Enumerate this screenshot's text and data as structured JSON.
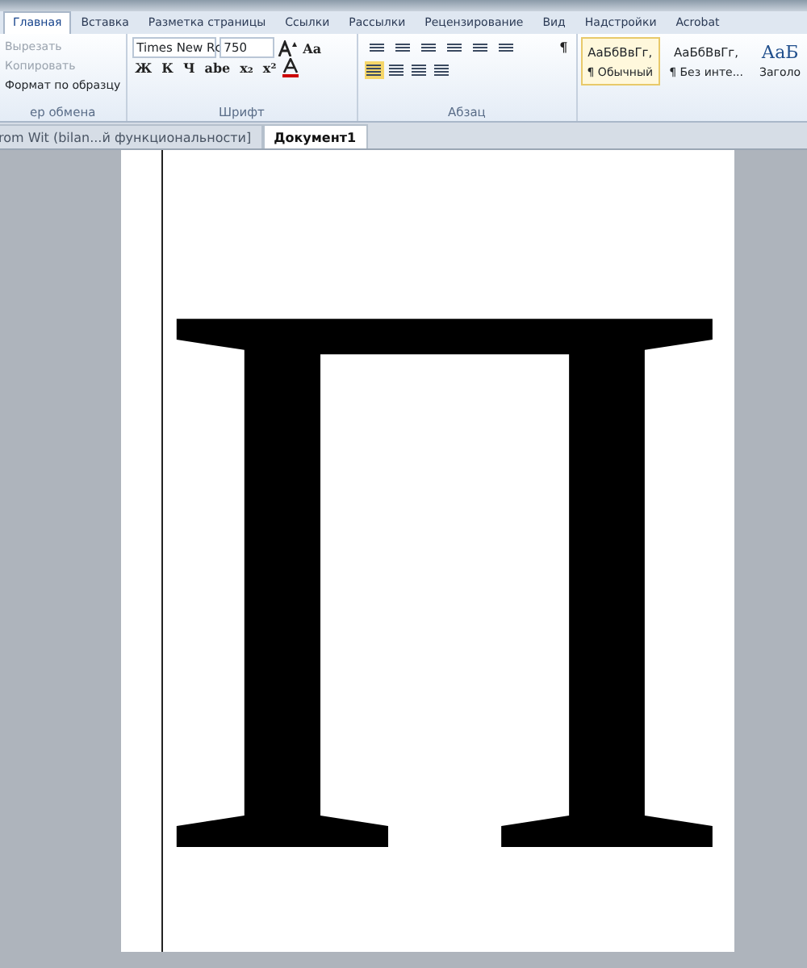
{
  "ribbon_tabs": [
    {
      "label": "Главная",
      "selected": true
    },
    {
      "label": "Вставка",
      "selected": false
    },
    {
      "label": "Разметка страницы",
      "selected": false
    },
    {
      "label": "Ссылки",
      "selected": false
    },
    {
      "label": "Рассылки",
      "selected": false
    },
    {
      "label": "Рецензирование",
      "selected": false
    },
    {
      "label": "Вид",
      "selected": false
    },
    {
      "label": "Надстройки",
      "selected": false
    },
    {
      "label": "Acrobat",
      "selected": false
    }
  ],
  "clipboard": {
    "items": [
      {
        "label": "Вырезать",
        "disabled": true
      },
      {
        "label": "Копировать",
        "disabled": true
      },
      {
        "label": "Формат по образцу",
        "disabled": false
      }
    ],
    "group_label": "ер обмена"
  },
  "font": {
    "name": "Times New Rc",
    "size": "750",
    "case_button": "Aa",
    "format_buttons": [
      "Ж",
      "К",
      "Ч",
      "abe",
      "x₂",
      "x²"
    ],
    "group_label": "Шрифт"
  },
  "paragraph": {
    "pilcrow": "¶",
    "group_label": "Абзац"
  },
  "styles": [
    {
      "sample": "АаБбВвГг,",
      "name": "¶ Обычный",
      "selected": true
    },
    {
      "sample": "АаБбВвГг,",
      "name": "¶ Без инте...",
      "selected": false
    },
    {
      "sample": "АаБ",
      "name": "Заголо",
      "selected": false
    }
  ],
  "document_tabs": [
    {
      "title": "rom Wit (bilan...й функциональности]",
      "selected": false
    },
    {
      "title": "Документ1",
      "selected": true
    }
  ],
  "document": {
    "text": "П"
  }
}
